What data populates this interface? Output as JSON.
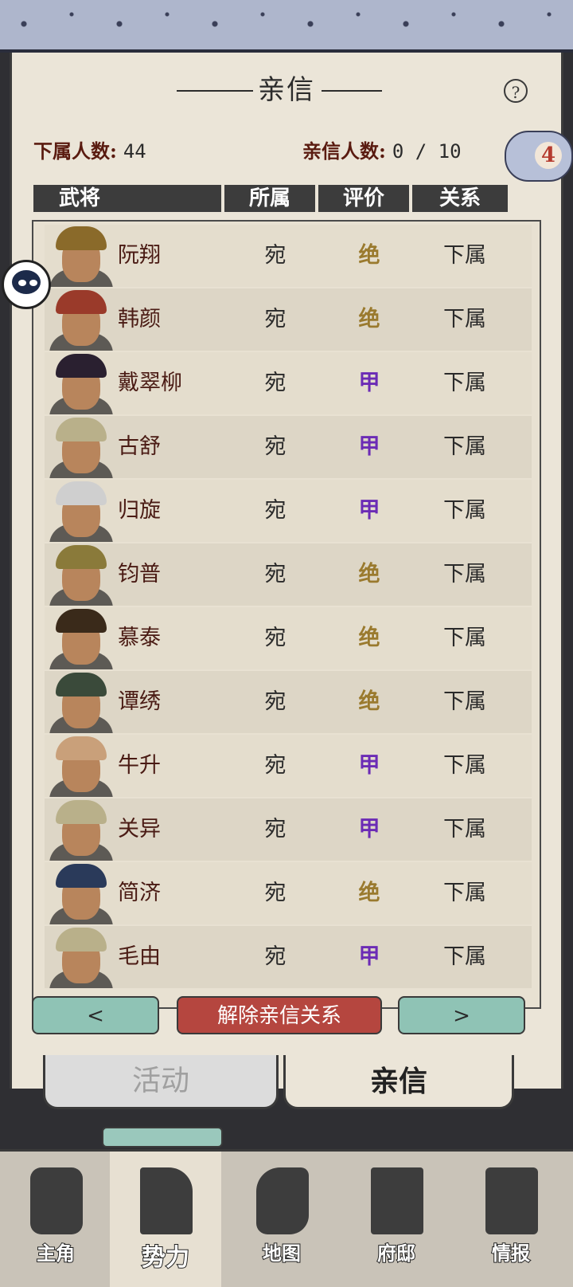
{
  "title": "亲信",
  "stats": {
    "subordinates_label": "下属人数:",
    "subordinates_value": "44",
    "confidants_label": "亲信人数:",
    "confidants_value": "0 / 10"
  },
  "badge": "4",
  "columns": [
    "武将",
    "所属",
    "评价",
    "关系"
  ],
  "generals": [
    {
      "name": "阮翔",
      "faction": "宛",
      "rating": "绝",
      "relation": "下属"
    },
    {
      "name": "韩颜",
      "faction": "宛",
      "rating": "绝",
      "relation": "下属"
    },
    {
      "name": "戴翠柳",
      "faction": "宛",
      "rating": "甲",
      "relation": "下属"
    },
    {
      "name": "古舒",
      "faction": "宛",
      "rating": "甲",
      "relation": "下属"
    },
    {
      "name": "归旋",
      "faction": "宛",
      "rating": "甲",
      "relation": "下属"
    },
    {
      "name": "钧普",
      "faction": "宛",
      "rating": "绝",
      "relation": "下属"
    },
    {
      "name": "慕泰",
      "faction": "宛",
      "rating": "绝",
      "relation": "下属"
    },
    {
      "name": "谭绣",
      "faction": "宛",
      "rating": "绝",
      "relation": "下属"
    },
    {
      "name": "牛升",
      "faction": "宛",
      "rating": "甲",
      "relation": "下属"
    },
    {
      "name": "关异",
      "faction": "宛",
      "rating": "甲",
      "relation": "下属"
    },
    {
      "name": "简济",
      "faction": "宛",
      "rating": "绝",
      "relation": "下属"
    },
    {
      "name": "毛由",
      "faction": "宛",
      "rating": "甲",
      "relation": "下属"
    }
  ],
  "buttons": {
    "prev": "<",
    "remove": "解除亲信关系",
    "next": ">"
  },
  "tabs": {
    "activity": "活动",
    "confidant": "亲信"
  },
  "bottom_nav": [
    "主角",
    "势力",
    "地图",
    "府邸",
    "情报"
  ],
  "colors": {
    "rating_jue": "#9a7a2e",
    "rating_jia": "#6b2bb5",
    "danger": "#b5463f",
    "nav_button": "#8fc3b5"
  }
}
